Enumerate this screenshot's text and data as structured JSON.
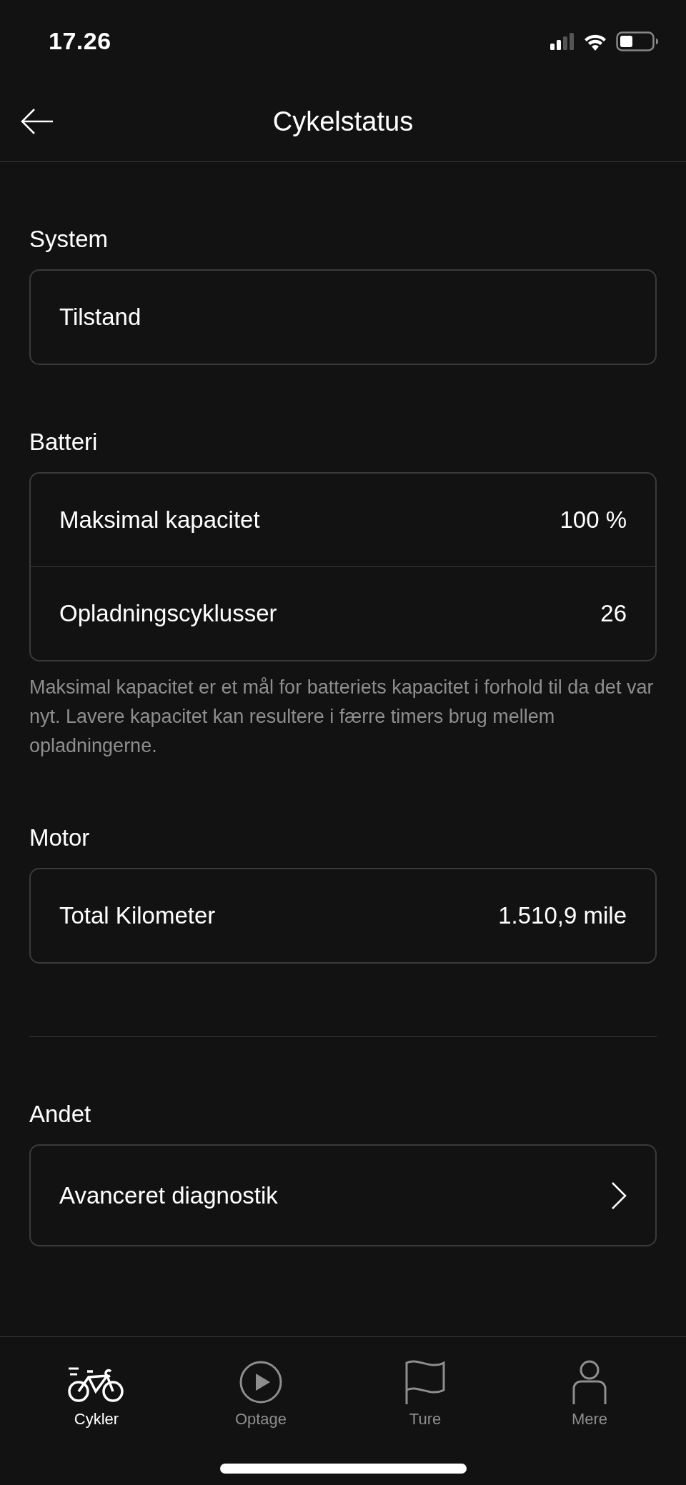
{
  "status_bar": {
    "time": "17.26"
  },
  "header": {
    "title": "Cykelstatus"
  },
  "sections": [
    {
      "title": "System",
      "divider_before": false,
      "rows": [
        {
          "kind": "plain",
          "label": "Tilstand"
        }
      ]
    },
    {
      "title": "Batteri",
      "divider_before": false,
      "rows": [
        {
          "kind": "value",
          "label": "Maksimal kapacitet",
          "value": "100 %"
        },
        {
          "kind": "value",
          "label": "Opladningscyklusser",
          "value": "26"
        }
      ],
      "note": "Maksimal kapacitet er et mål for batteriets kapacitet i forhold til da det var nyt. Lavere kapacitet kan resultere i færre timers brug mellem opladningerne."
    },
    {
      "title": "Motor",
      "divider_before": false,
      "rows": [
        {
          "kind": "value",
          "label": "Total Kilometer",
          "value": "1.510,9 mile"
        }
      ]
    },
    {
      "title": "Andet",
      "divider_before": true,
      "rows": [
        {
          "kind": "link",
          "label": "Avanceret diagnostik"
        }
      ]
    }
  ],
  "tabs": [
    {
      "kind": "bike",
      "label": "Cykler",
      "selected": true
    },
    {
      "kind": "record",
      "label": "Optage",
      "selected": false
    },
    {
      "kind": "trips",
      "label": "Ture",
      "selected": false
    },
    {
      "kind": "profile",
      "label": "Mere",
      "selected": false
    }
  ]
}
